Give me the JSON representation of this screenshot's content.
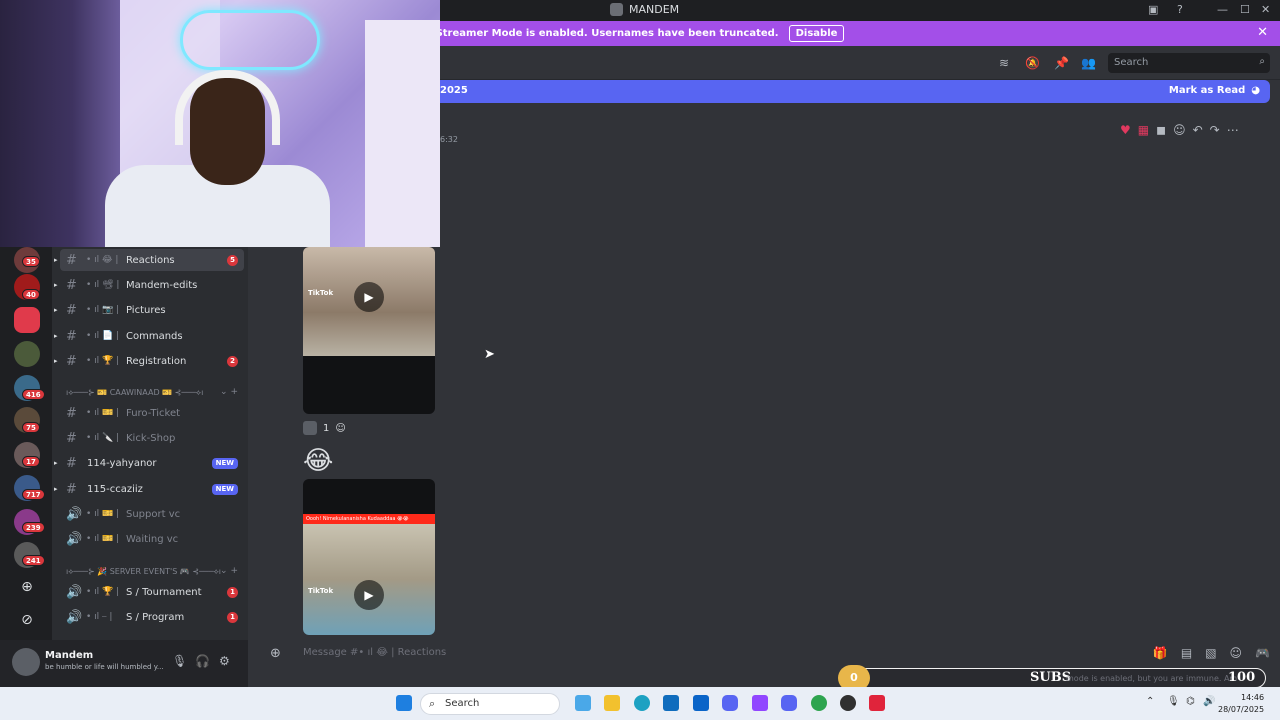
{
  "window": {
    "title": "MANDEM"
  },
  "banner": {
    "text": "Streamer Mode is enabled. Usernames have been truncated.",
    "button": "Disable"
  },
  "header": {
    "search_placeholder": "Search"
  },
  "new_messages": {
    "date_fragment": "2025",
    "mark_read": "Mark as Read"
  },
  "message": {
    "time_fragment": "6:32"
  },
  "rail": {
    "badges": [
      "35",
      "40",
      "416",
      "75",
      "17",
      "717",
      "239",
      "241"
    ]
  },
  "channels": [
    {
      "prefix": "• ıl 😂 |",
      "label": "Reactions",
      "badge": "5",
      "selected": true,
      "muted": false
    },
    {
      "prefix": "• ıl 📽 |",
      "label": "Mandem-edits",
      "badge": "",
      "muted": false
    },
    {
      "prefix": "• ıl 📷 |",
      "label": "Pictures",
      "badge": "",
      "muted": false
    },
    {
      "prefix": "• ıl 📄 |",
      "label": "Commands",
      "badge": "",
      "muted": false
    },
    {
      "prefix": "• ıl 🏆 |",
      "label": "Registration",
      "badge": "2",
      "muted": false
    },
    {
      "prefix": "• ıl 🎫 |",
      "label": "Furo-Ticket",
      "badge": "",
      "muted": true
    },
    {
      "prefix": "• ıl 🔪 |",
      "label": "Kick-Shop",
      "badge": "",
      "muted": true
    },
    {
      "prefix": "",
      "label": "114-yahyanor",
      "new": "NEW",
      "muted": false
    },
    {
      "prefix": "",
      "label": "115-ccaziiz",
      "new": "NEW",
      "muted": false
    },
    {
      "prefix": "• ıl 🎫 |",
      "label": "Support vc",
      "badge": "",
      "muted": true
    },
    {
      "prefix": "• ıl 🎫 |",
      "label": "Waiting vc",
      "badge": "",
      "muted": true
    },
    {
      "prefix": "• ıl 🏆 |",
      "label": "S / Tournament",
      "badge": "1",
      "muted": false
    },
    {
      "prefix": "• ıl ⎯ |",
      "label": "S / Program",
      "badge": "1",
      "muted": false
    }
  ],
  "categories": [
    {
      "label": "ı⟡───⊱ 🎫 CAAWINAAD 🎫 ⊰───⟡ı"
    },
    {
      "label": "ı⟡───⊱ 🎉 SERVER EVENT'S 🎮 ⊰───⟡ı"
    }
  ],
  "user": {
    "name": "Mandem",
    "status": "be humble or life will humbled y..."
  },
  "media": [
    {
      "watermark": "TikTok"
    },
    {
      "watermark": "TikTok",
      "caption": "Oooh! Nimekulananisha Kudaaddaa 😭😭"
    }
  ],
  "reaction": {
    "count": "1"
  },
  "composer": {
    "placeholder_prefix": "Message #• ıl 😂",
    "placeholder_channel": "| Reactions"
  },
  "subs_bar": {
    "current": "0",
    "label": "SUBS",
    "goal": "100",
    "ghost_text": "mode is enabled, but you are immune. Am"
  },
  "taskbar": {
    "search": "Search",
    "time": "14:46",
    "date": "28/07/2025"
  },
  "colors": {
    "accent": "#5865f2",
    "banner": "#a34fe8",
    "badge": "#da373c"
  }
}
